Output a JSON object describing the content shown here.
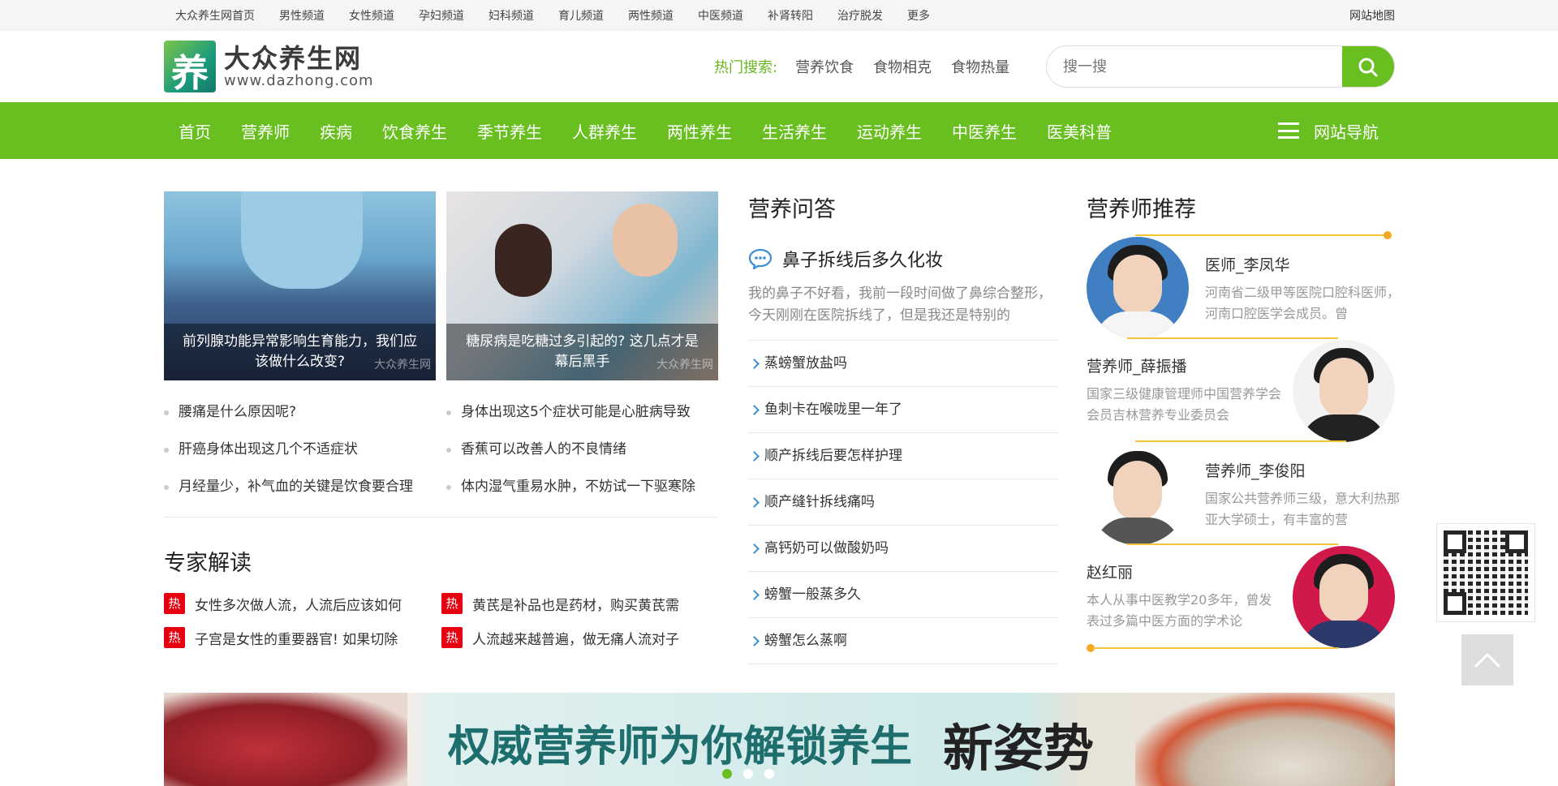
{
  "topbar": {
    "links": [
      "大众养生网首页",
      "男性频道",
      "女性频道",
      "孕妇频道",
      "妇科频道",
      "育儿频道",
      "两性频道",
      "中医频道",
      "补肾转阳",
      "治疗脱发",
      "更多"
    ],
    "sitemap": "网站地图"
  },
  "header": {
    "logo_mark": "养",
    "logo_cn": "大众养生网",
    "logo_en": "www.dazhong.com",
    "hot_label": "热门搜索:",
    "hot_links": [
      "营养饮食",
      "食物相克",
      "食物热量"
    ],
    "search_placeholder": "搜一搜",
    "search_icon": "search-icon"
  },
  "nav": {
    "items": [
      "首页",
      "营养师",
      "疾病",
      "饮食养生",
      "季节养生",
      "人群养生",
      "两性养生",
      "生活养生",
      "运动养生",
      "中医养生",
      "医美科普"
    ],
    "right_label": "网站导航",
    "right_icon": "menu-icon"
  },
  "featured": [
    {
      "caption": "前列腺功能异常影响生育能力，我们应该做什么改变?",
      "watermark": "大众养生网"
    },
    {
      "caption": "糖尿病是吃糖过多引起的? 这几点才是幕后黑手",
      "watermark": "大众养生网"
    }
  ],
  "news": {
    "left": [
      "腰痛是什么原因呢?",
      "肝癌身体出现这几个不适症状",
      "月经量少，补气血的关键是饮食要合理"
    ],
    "right": [
      "身体出现这5个症状可能是心脏病导致",
      "香蕉可以改善人的不良情绪",
      "体内湿气重易水肿，不妨试一下驱寒除"
    ]
  },
  "expert": {
    "title": "专家解读",
    "badge": "热",
    "items": [
      "女性多次做人流，人流后应该如何",
      "黄芪是补品也是药材，购买黄芪需",
      "子宫是女性的重要器官! 如果切除",
      "人流越来越普遍，做无痛人流对子"
    ]
  },
  "qa": {
    "title": "营养问答",
    "featured_title": "鼻子拆线后多久化妆",
    "featured_desc": "我的鼻子不好看，我前一段时间做了鼻综合整形，今天刚刚在医院拆线了，但是我还是特别的",
    "list": [
      "蒸螃蟹放盐吗",
      "鱼刺卡在喉咙里一年了",
      "顺产拆线后要怎样护理",
      "顺产缝针拆线痛吗",
      "高钙奶可以做酸奶吗",
      "螃蟹一般蒸多久",
      "螃蟹怎么蒸啊"
    ]
  },
  "dietitians": {
    "title": "营养师推荐",
    "list": [
      {
        "name": "医师_李凤华",
        "desc": "河南省二级甲等医院口腔科医师，河南口腔医学会成员。曾"
      },
      {
        "name": "营养师_薛振播",
        "desc": "国家三级健康管理师中国营养学会会员吉林营养专业委员会"
      },
      {
        "name": "营养师_李俊阳",
        "desc": "国家公共营养师三级，意大利热那亚大学硕士，有丰富的营"
      },
      {
        "name": "赵红丽",
        "desc": "本人从事中医教学20多年，曾发表过多篇中医方面的学术论"
      }
    ]
  },
  "banner": {
    "text": "权威营养师为你解锁养生",
    "text2": "新姿势"
  },
  "colors": {
    "brand_green": "#69be20",
    "hot_red": "#e60012",
    "accent_yellow": "#f3c237",
    "link_blue": "#3b8ed6"
  }
}
